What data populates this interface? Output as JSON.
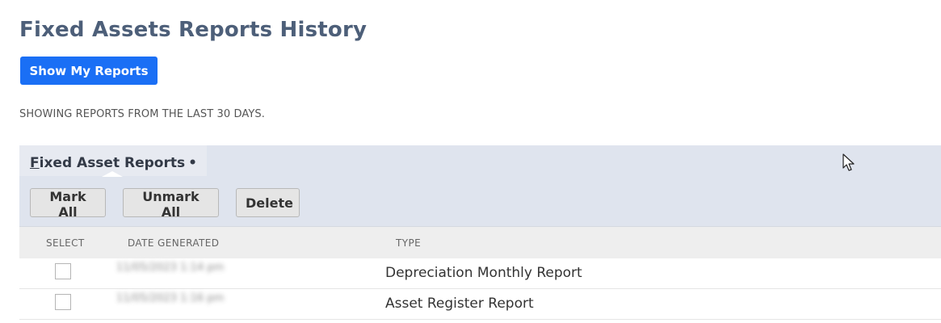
{
  "page": {
    "title": "Fixed Assets Reports History",
    "show_reports_label": "Show My Reports",
    "notice": "SHOWING REPORTS FROM THE LAST 30 DAYS."
  },
  "panel": {
    "subtab_first_letter": "F",
    "subtab_rest": "ixed Asset Reports",
    "subtab_dot": "•",
    "buttons": {
      "mark_all": "Mark All",
      "unmark_all": "Unmark All",
      "delete": "Delete"
    },
    "columns": {
      "select": "SELECT",
      "date": "DATE GENERATED",
      "type": "TYPE"
    },
    "rows": [
      {
        "date": "11/05/2023 1:14 pm",
        "type": "Depreciation Monthly Report",
        "selected": false
      },
      {
        "date": "11/05/2023 1:16 pm",
        "type": "Asset Register Report",
        "selected": false
      }
    ]
  },
  "icons": {
    "cursor": "mouse-pointer-icon"
  },
  "colors": {
    "title": "#4d5f79",
    "primary_button": "#1a6ff5",
    "panel_header": "#dfe4ee"
  }
}
